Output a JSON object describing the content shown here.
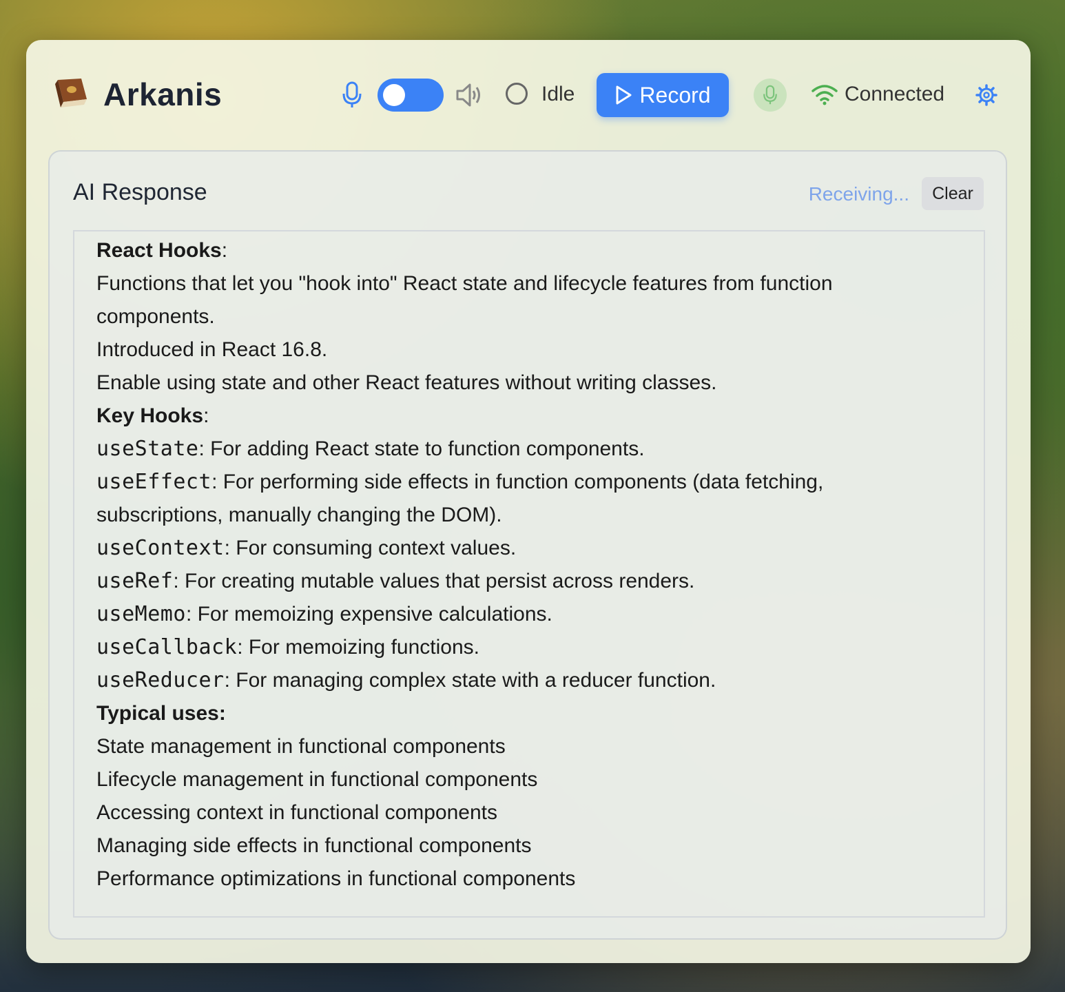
{
  "app": {
    "name": "Arkanis"
  },
  "toolbar": {
    "status_text": "Idle",
    "record_label": "Record",
    "connection_text": "Connected",
    "accent_color": "#3b82f6",
    "connection_color": "#4caf50"
  },
  "panel": {
    "title": "AI Response",
    "receiving_text": "Receiving...",
    "clear_label": "Clear"
  },
  "content": {
    "react_hooks_heading": "React Hooks",
    "react_hooks_lines": [
      "Functions that let you \"hook into\" React state and lifecycle features from function components.",
      "Introduced in React 16.8.",
      "Enable using state and other React features without writing classes."
    ],
    "key_hooks_heading": "Key Hooks",
    "hooks": [
      {
        "name": "useState",
        "desc": ": For adding React state to function components."
      },
      {
        "name": "useEffect",
        "desc": ": For performing side effects in function components (data fetching, subscriptions, manually changing the DOM)."
      },
      {
        "name": "useContext",
        "desc": ": For consuming context values."
      },
      {
        "name": "useRef",
        "desc": ": For creating mutable values that persist across renders."
      },
      {
        "name": "useMemo",
        "desc": ": For memoizing expensive calculations."
      },
      {
        "name": "useCallback",
        "desc": ": For memoizing functions."
      },
      {
        "name": "useReducer",
        "desc": ": For managing complex state with a reducer function."
      }
    ],
    "typical_uses_heading": "Typical uses:",
    "typical_uses": [
      "State management in functional components",
      "Lifecycle management in functional components",
      "Accessing context in functional components",
      "Managing side effects in functional components",
      "Performance optimizations in functional components"
    ]
  }
}
